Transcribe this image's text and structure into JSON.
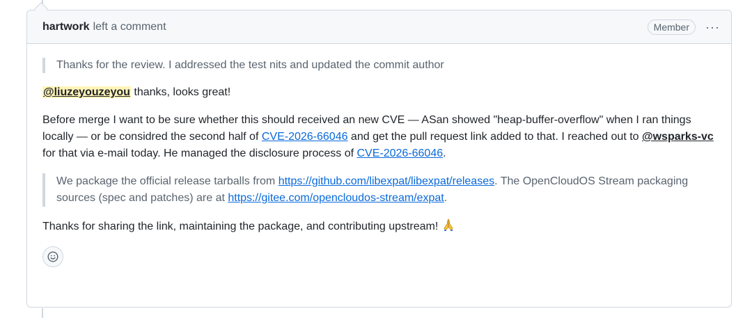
{
  "header": {
    "author": "hartwork",
    "action": "left a comment",
    "badge": "Member",
    "more_icon": "kebab-horizontal-icon"
  },
  "comment": {
    "quote_1": "Thanks for the review. I addressed the test nits and updated the commit author",
    "p1": {
      "mention": "@liuzeyouzeyou",
      "text": " thanks, looks great!"
    },
    "p2": {
      "t1": "Before merge I want to be sure whether this should received an new CVE — ASan showed \"heap-buffer-overflow\" when I ran things locally — or be considred the second half of ",
      "cve_link_1": "CVE-2026-66046",
      "t2": " and get the pull request link added to that. I reached out to ",
      "mention": "@wsparks-vc",
      "t3": " for that via e-mail today. He managed the disclosure process of ",
      "cve_link_2": "CVE-2026-66046",
      "t4": "."
    },
    "quote_2": {
      "t1": "We package the official release tarballs from ",
      "link_1": "https://github.com/libexpat/libexpat/releases",
      "t2": ". The OpenCloudOS Stream packaging sources (spec and patches) are at ",
      "link_2": "https://gitee.com/opencloudos-stream/expat",
      "t3": "."
    },
    "p3": {
      "text": "Thanks for sharing the link, maintaining the package, and contributing upstream! ",
      "emoji": "folded-hands-emoji"
    },
    "reaction_icon": "smiley-icon"
  },
  "colors": {
    "link": "#0969da",
    "mention_highlight": "#fff4b8",
    "border": "#d0d7de",
    "header_bg": "#f6f8fa"
  }
}
